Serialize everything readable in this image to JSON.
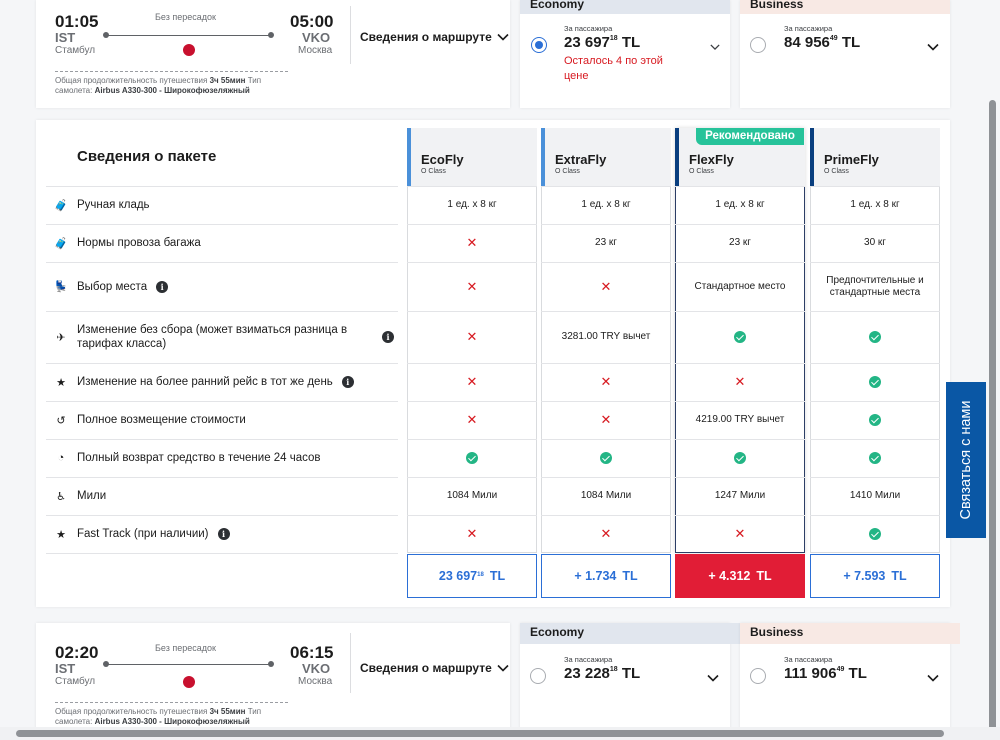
{
  "flight1": {
    "dep_time": "01:05",
    "dep_code": "IST",
    "dep_city": "Стамбул",
    "arr_time": "05:00",
    "arr_code": "VKO",
    "arr_city": "Москва",
    "nonstop": "Без пересадок",
    "details_label": "Сведения о маршруте",
    "meta_line1_label": "Общая продолжительность путешествия",
    "meta_line1_value": "3ч 55мин",
    "meta_line1_suffix": "Тип",
    "meta_line2_label": "самолета:",
    "meta_line2_value": "Airbus A330-300 - Широкофюзеляжный",
    "economy": {
      "label": "Economy",
      "per_pax": "За пассажира",
      "price_main": "23 697",
      "price_cents": "18",
      "currency": "TL",
      "warning": "Осталось 4 по этой цене",
      "selected": true
    },
    "business": {
      "label": "Business",
      "per_pax": "За пассажира",
      "price_main": "84 956",
      "price_cents": "49",
      "currency": "TL",
      "selected": false
    }
  },
  "package": {
    "title": "Сведения о пакете",
    "recommended_label": "Рекомендовано",
    "columns": [
      {
        "brand": "EcoFly",
        "class": "O Class",
        "accent": "#4a90d9"
      },
      {
        "brand": "ExtraFly",
        "class": "O Class",
        "accent": "#4a90d9"
      },
      {
        "brand": "FlexFly",
        "class": "O Class",
        "accent": "#0a3f7f"
      },
      {
        "brand": "PrimeFly",
        "class": "O Class",
        "accent": "#0a3f7f"
      }
    ],
    "features": [
      {
        "label": "Ручная кладь",
        "icon": "bag-icon",
        "glyph": "🧳",
        "info": false,
        "cells": [
          "1 ед. x 8 кг",
          "1 ед. x 8 кг",
          "1 ед. x 8 кг",
          "1 ед. x 8 кг"
        ]
      },
      {
        "label": "Нормы провоза багажа",
        "icon": "luggage-icon",
        "glyph": "🧳",
        "info": false,
        "cells": [
          "x",
          "23 кг",
          "23 кг",
          "30 кг"
        ]
      },
      {
        "label": "Выбор места",
        "icon": "seat-icon",
        "glyph": "💺",
        "info": true,
        "cells": [
          "x",
          "x",
          "Стандартное место",
          "Предпочтительные и стандартные места"
        ]
      },
      {
        "label": "Изменение без сбора (может взиматься разница в тарифах класса)",
        "icon": "change-icon",
        "glyph": "✈",
        "info": true,
        "cells": [
          "x",
          "3281.00 TRY вычет",
          "check",
          "check"
        ]
      },
      {
        "label": "Изменение на более ранний рейс в тот же день",
        "icon": "star-icon",
        "glyph": "★",
        "info": true,
        "cells": [
          "x",
          "x",
          "x",
          "check"
        ]
      },
      {
        "label": "Полное возмещение стоимости",
        "icon": "refund-icon",
        "glyph": "↺",
        "info": false,
        "cells": [
          "x",
          "x",
          "4219.00 TRY вычет",
          "check"
        ]
      },
      {
        "label": "Полный возврат средство в течение 24 часов",
        "icon": "refund24-icon",
        "glyph": "◔",
        "info": false,
        "cells": [
          "check",
          "check",
          "check",
          "check"
        ]
      },
      {
        "label": "Мили",
        "icon": "miles-icon",
        "glyph": "♿",
        "info": false,
        "cells": [
          "1084 Мили",
          "1084 Мили",
          "1247 Мили",
          "1410 Мили"
        ]
      },
      {
        "label": "Fast Track (при наличии)",
        "icon": "fasttrack-icon",
        "glyph": "★",
        "info": true,
        "cells": [
          "x",
          "x",
          "x",
          "check"
        ]
      }
    ],
    "prices": [
      {
        "main": "23 697",
        "cents": "18",
        "currency": "TL",
        "selected": false
      },
      {
        "main": "+ 1.734",
        "cents": "",
        "currency": "TL",
        "selected": false
      },
      {
        "main": "+ 4.312",
        "cents": "",
        "currency": "TL",
        "selected": true
      },
      {
        "main": "+ 7.593",
        "cents": "",
        "currency": "TL",
        "selected": false
      }
    ]
  },
  "flight2": {
    "dep_time": "02:20",
    "dep_code": "IST",
    "dep_city": "Стамбул",
    "arr_time": "06:15",
    "arr_code": "VKO",
    "arr_city": "Москва",
    "nonstop": "Без пересадок",
    "details_label": "Сведения о маршруте",
    "meta_line1_label": "Общая продолжительность путешествия",
    "meta_line1_value": "3ч 55мин",
    "meta_line1_suffix": "Тип",
    "meta_line2_label": "самолета:",
    "meta_line2_value": "Airbus A330-300 - Широкофюзеляжный",
    "economy": {
      "label": "Economy",
      "per_pax": "За пассажира",
      "price_main": "23 228",
      "price_cents": "18",
      "currency": "TL",
      "selected": false
    },
    "business": {
      "label": "Business",
      "per_pax": "За пассажира",
      "price_main": "111 906",
      "price_cents": "49",
      "currency": "TL",
      "selected": false
    }
  },
  "contact_label": "Связаться с нами",
  "colors": {
    "brand_blue": "#2b6fd6",
    "selected_red": "#e11d36",
    "recommended_green": "#27c39a",
    "economy_header": "#e1e6ee",
    "business_header": "#f8e9e4"
  }
}
